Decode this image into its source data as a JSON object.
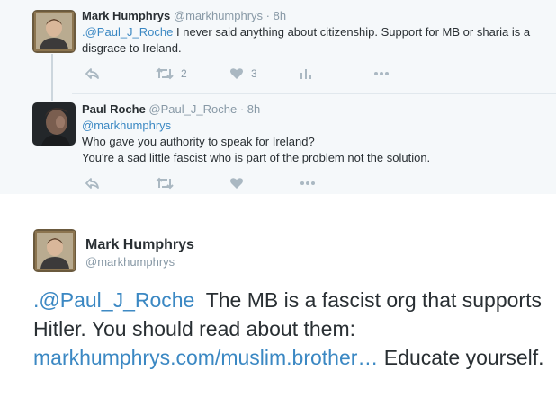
{
  "tweets": [
    {
      "name": "Mark Humphrys",
      "handle": "@markhumphrys",
      "time": "8h",
      "mention": ".@Paul_J_Roche",
      "text": " I never said anything about citizenship. Support for MB or sharia is a disgrace to Ireland.",
      "retweets": "2",
      "likes": "3"
    },
    {
      "name": "Paul Roche",
      "handle": "@Paul_J_Roche",
      "time": "8h",
      "mention": "@markhumphrys",
      "line1": "Who gave you authority to speak for Ireland?",
      "line2": "You're a sad little fascist who is part of the problem not the solution."
    }
  ],
  "main_tweet": {
    "name": "Mark Humphrys",
    "handle": "@markhumphrys",
    "mention": ".@Paul_J_Roche",
    "text1": "  The MB is a fascist org that supports Hitler. You should read about them: ",
    "link": "markhumphrys.com/muslim.brother…",
    "text2": " Educate yourself."
  },
  "separator": "·",
  "icons": [
    "reply-icon",
    "retweet-icon",
    "like-icon",
    "analytics-icon",
    "more-icon"
  ],
  "colors": {
    "link": "#3b88c3",
    "muted": "#8899a6",
    "icon": "#aab8c2",
    "thread_bg": "#f5f8fa"
  }
}
